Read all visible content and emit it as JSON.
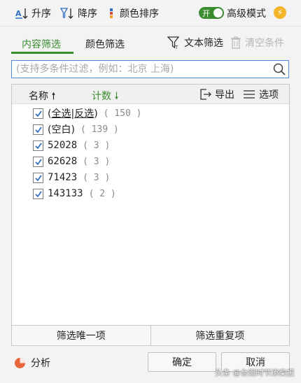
{
  "toolbar": {
    "sort_asc": "升序",
    "sort_desc": "降序",
    "color_sort": "颜色排序",
    "toggle_on": "开",
    "advanced_mode": "高级模式",
    "bolt_icon": "lightning-bolt-icon"
  },
  "tabs": {
    "content_filter": "内容筛选",
    "color_filter": "颜色筛选",
    "text_filter": "文本筛选",
    "clear_conditions": "清空条件"
  },
  "search": {
    "value": "",
    "placeholder": "(支持多条件过滤，例如：北京 上海)"
  },
  "list_header": {
    "name": "名称",
    "count": "计数",
    "export": "导出",
    "options": "选项"
  },
  "items": [
    {
      "select_all": "全选",
      "invert": "反选",
      "count": "( 150 )",
      "checked": true
    },
    {
      "label": "(空白)",
      "count": "( 139 )",
      "checked": true
    },
    {
      "label": "52028",
      "count": "( 3 )",
      "checked": true
    },
    {
      "label": "62628",
      "count": "( 3 )",
      "checked": true
    },
    {
      "label": "71423",
      "count": "( 3 )",
      "checked": true
    },
    {
      "label": "143133",
      "count": "( 2 )",
      "checked": true
    }
  ],
  "bottom": {
    "unique": "筛选唯一项",
    "duplicate": "筛选重复项",
    "analyze": "分析",
    "ok": "确定",
    "cancel": "取消"
  },
  "watermark": "头条 @台雨时节添柴报",
  "colors": {
    "accent_green": "#3a8d2f",
    "search_border": "#4f8ad6",
    "bolt": "#f5b52a",
    "analyze_icon": "#e8663a"
  }
}
